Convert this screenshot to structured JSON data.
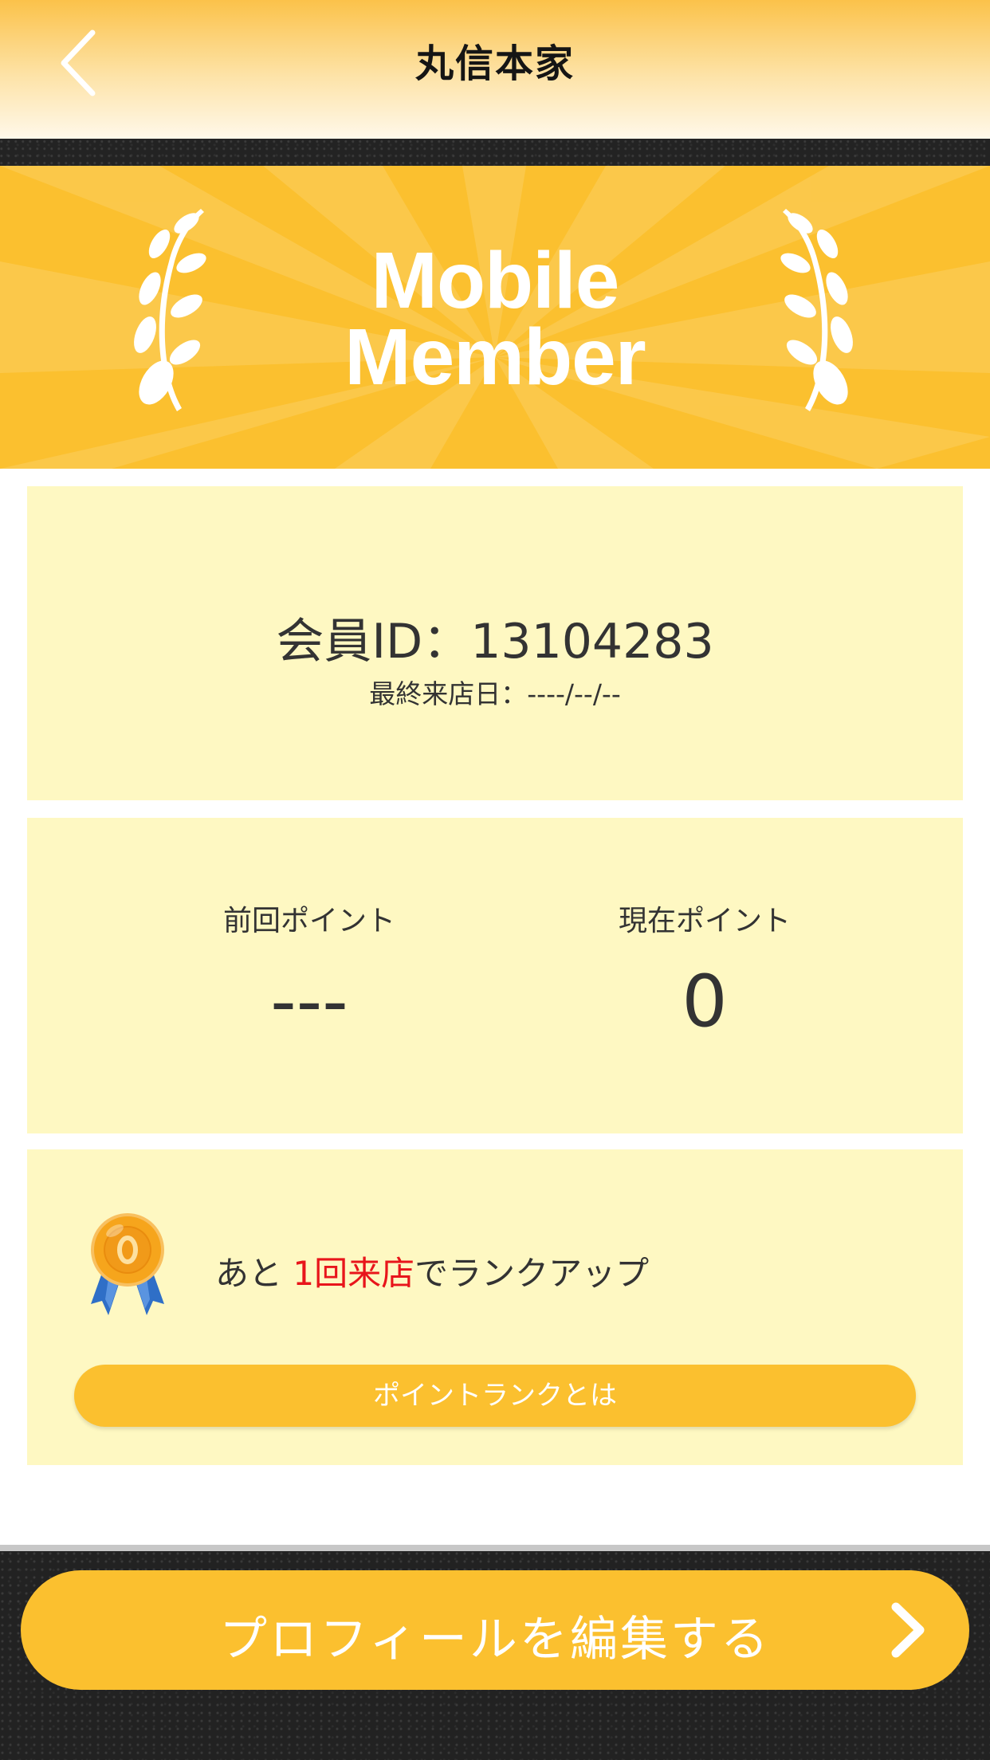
{
  "header": {
    "title": "丸信本家",
    "back_icon": "chevron-left-icon"
  },
  "banner": {
    "line1": "Mobile",
    "line2": "Member",
    "left_icon": "laurel-branch-icon",
    "right_icon": "laurel-branch-icon"
  },
  "member": {
    "id_label": "会員ID：13104283",
    "last_visit": "最終来店日：----/--/--"
  },
  "points": {
    "previous_label": "前回ポイント",
    "previous_value": "---",
    "current_label": "現在ポイント",
    "current_value": "0"
  },
  "rank": {
    "medal_icon": "medal-icon",
    "message_prefix": "あと ",
    "message_highlight": "1回来店",
    "message_suffix": "でランクアップ",
    "button_label": "ポイントランクとは"
  },
  "footer": {
    "profile_button_label": "プロフィールを編集する",
    "chevron_icon": "chevron-right-icon"
  },
  "colors": {
    "accent": "#fbc02f",
    "card_bg": "#fef8c2",
    "highlight": "#e8151b",
    "dark": "#232323"
  }
}
